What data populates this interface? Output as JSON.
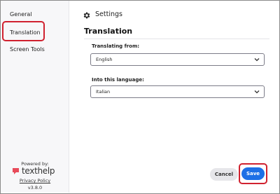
{
  "sidebar": {
    "items": [
      {
        "label": "General"
      },
      {
        "label": "Translation"
      },
      {
        "label": "Screen Tools"
      }
    ],
    "powered_by": "Powered by:",
    "brand": "texthelp",
    "privacy_link": "Privacy Policy",
    "version": "v3.8.0"
  },
  "header": {
    "icon": "gear-icon",
    "title": "Settings"
  },
  "main": {
    "title": "Translation",
    "from_label": "Translating from:",
    "from_value": "English",
    "into_label": "Into this language:",
    "into_value": "Italian"
  },
  "buttons": {
    "cancel": "Cancel",
    "save": "Save"
  },
  "colors": {
    "accent": "#1d6fe6",
    "highlight": "#d0212f",
    "brand": "#e84b5a"
  }
}
